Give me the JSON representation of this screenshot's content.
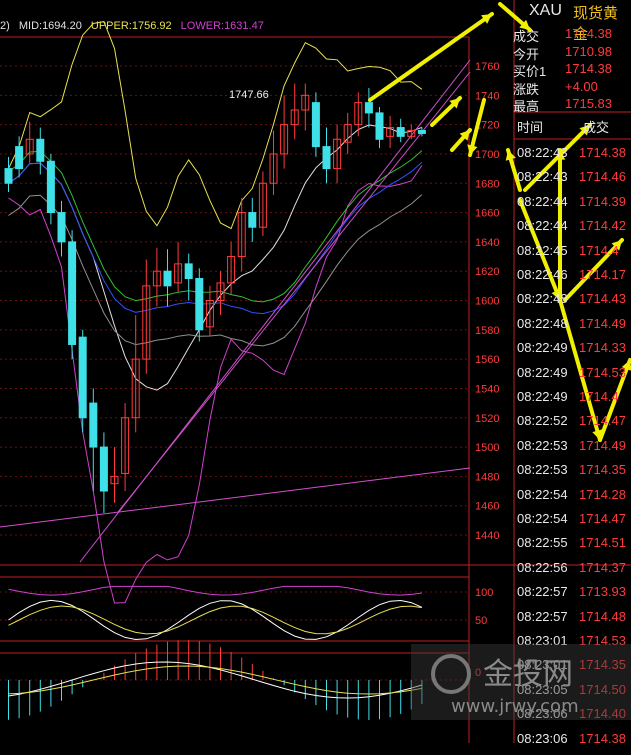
{
  "header": {
    "prefix": "2)",
    "mid": "MID:1694.20",
    "upper": "UPPER:1756.92",
    "lower": "LOWER:1631.47"
  },
  "symbol": {
    "code": "XAU",
    "name": "现货黄金"
  },
  "quote": [
    {
      "label": "成交",
      "value": "1714.38"
    },
    {
      "label": "今开",
      "value": "1710.98"
    },
    {
      "label": "买价1",
      "value": "1714.38"
    },
    {
      "label": "涨跌",
      "value": "+4.00"
    },
    {
      "label": "最高",
      "value": "1715.83"
    }
  ],
  "trades_header": {
    "time": "时间",
    "price": "成交"
  },
  "trades": [
    {
      "time": "08:22:43",
      "price": "1714.38"
    },
    {
      "time": "08:22:43",
      "price": "1714.46"
    },
    {
      "time": "08:22:44",
      "price": "1714.39"
    },
    {
      "time": "08:22:44",
      "price": "1714.42"
    },
    {
      "time": "08:22:45",
      "price": "1714.4"
    },
    {
      "time": "08:22:46",
      "price": "1714.17"
    },
    {
      "time": "08:22:48",
      "price": "1714.43"
    },
    {
      "time": "08:22:48",
      "price": "1714.49"
    },
    {
      "time": "08:22:49",
      "price": "1714.33"
    },
    {
      "time": "08:22:49",
      "price": "1714.53"
    },
    {
      "time": "08:22:49",
      "price": "1714.4"
    },
    {
      "time": "08:22:52",
      "price": "1714.47"
    },
    {
      "time": "08:22:53",
      "price": "1714.49"
    },
    {
      "time": "08:22:53",
      "price": "1714.35"
    },
    {
      "time": "08:22:54",
      "price": "1714.28"
    },
    {
      "time": "08:22:54",
      "price": "1714.47"
    },
    {
      "time": "08:22:55",
      "price": "1714.51"
    },
    {
      "time": "08:22:56",
      "price": "1714.37"
    },
    {
      "time": "08:22:57",
      "price": "1713.93"
    },
    {
      "time": "08:22:57",
      "price": "1714.48"
    },
    {
      "time": "08:23:01",
      "price": "1714.53"
    },
    {
      "time": "08:23:01",
      "price": "1714.35"
    },
    {
      "time": "08:23:05",
      "price": "1714.50"
    },
    {
      "time": "08:23:06",
      "price": "1714.40"
    },
    {
      "time": "08:23:06",
      "price": "1714.38"
    }
  ],
  "chart_data": {
    "type": "candlestick",
    "y_ticks": [
      1760,
      1740,
      1720,
      1700,
      1680,
      1660,
      1640,
      1620,
      1600,
      1580,
      1560,
      1540,
      1520,
      1500,
      1480,
      1460,
      1440
    ],
    "ylim": [
      1430,
      1772
    ],
    "annotation": "1747.66",
    "colors": {
      "up": "#ff3b3b",
      "down": "#3fe0e8",
      "upper_band": "#e8e050",
      "mid_band": "#e0e0e0",
      "lower_band": "#d040d0"
    },
    "osc_ticks": [
      100,
      50
    ],
    "macd_ticks": [
      0
    ],
    "watermark": {
      "name": "金投网",
      "url": "www.jrwy.com"
    }
  }
}
